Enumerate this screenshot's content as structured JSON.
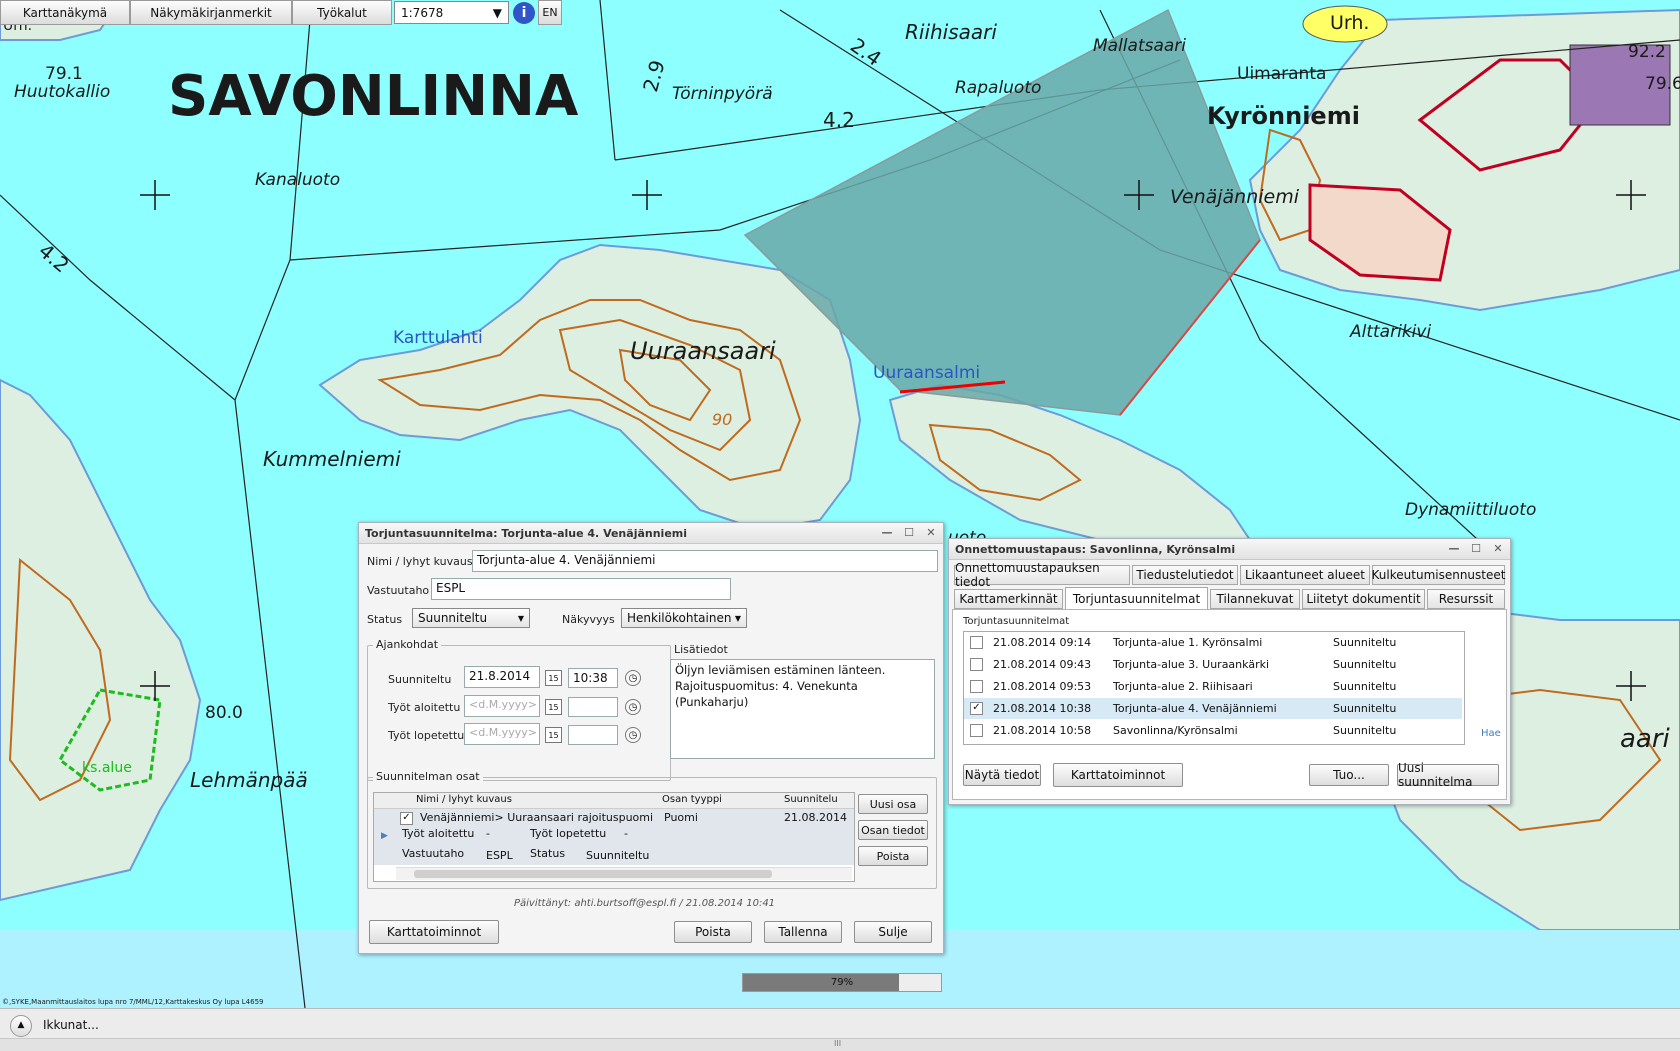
{
  "toolbar": {
    "items": [
      "Karttanäkymä",
      "Näkymäkirjanmerkit",
      "Työkalut"
    ],
    "scale": "1:7678",
    "info_icon": "info-icon",
    "lang": "EN"
  },
  "map": {
    "labels": {
      "savonlinna": "SAVONLINNA",
      "huutokallio": "Huutokallio",
      "height_79_1": "79.1",
      "kanaluoto": "Kanaluoto",
      "tornipyora": "Törninpyörä",
      "riihisaari": "Riihisaari",
      "mallatsaari": "Mallatsaari",
      "rapaluoto": "Rapaluoto",
      "kyronniemi": "Kyrönniemi",
      "uimaranta": "Uimaranta",
      "urh": "Urh.",
      "venajanniemi": "Venäjänniemi",
      "alttarikivi": "Alttarikivi",
      "karttulahti": "Karttulahti",
      "uuraansaari": "Uuraansaari",
      "uuraansalmi": "Uuraansalmi",
      "kummelniemi": "Kummelniemi",
      "dynamiittiluoto": "Dynamiittiluoto",
      "lehmanpaa": "Lehmänpää",
      "height_80_0": "80.0",
      "height_92_2": "92.2",
      "height_79_6": "79.6",
      "depth_4_2a": "4.2",
      "depth_4_2b": "4.2",
      "depth_2_4": "2.4",
      "depth_2_9": "2.9",
      "contour_90": "90",
      "ks_alue": "ks.alue",
      "urh_left": "Urh.",
      "saari_partial": "aari",
      "luoto_partial": "uoto"
    },
    "copyright": "©,SYKE,Maanmittauslaitos lupa nro 7/MML/12,Karttakeskus Oy lupa L4659",
    "colors": {
      "water": "#8effff",
      "land": "#dcefe0",
      "contour": "#c06a1e",
      "polygon": "#6aa8a8"
    }
  },
  "plan_window": {
    "title": "Torjuntasuunnitelma: Torjunta-alue 4. Venäjänniemi",
    "name_label": "Nimi / lyhyt kuvaus",
    "name_value": "Torjunta-alue 4. Venäjänniemi",
    "responsible_label": "Vastuutaho",
    "responsible_value": "ESPL",
    "status_label": "Status",
    "status_value": "Suunniteltu",
    "visibility_label": "Näkyvyys",
    "visibility_value": "Henkilökohtainen",
    "times_group": "Ajankohdat",
    "planned_label": "Suunniteltu",
    "planned_date": "21.8.2014",
    "planned_time": "10:38",
    "started_label": "Työt aloitettu",
    "ended_label": "Työt lopetettu",
    "date_placeholder": "<d.M.yyyy>",
    "cal_day": "15",
    "extra_label": "Lisätiedot",
    "extra_lines": [
      "Öljyn leviämisen estäminen länteen.",
      "Rajoituspuomitus: 4. Venekunta (Punkaharju)"
    ],
    "parts_group": "Suunnitelman osat",
    "parts_columns": [
      "Nimi / lyhyt kuvaus",
      "Osan tyyppi",
      "Suunnitelu"
    ],
    "part_row": {
      "name": "Venäjänniemi> Uuraansaari rajoituspuomi",
      "type": "Puomi",
      "date": "21.08.2014"
    },
    "part_detail": {
      "started_label": "Työt aloitettu",
      "started_value": "-",
      "ended_label": "Työt lopetettu",
      "ended_value": "-",
      "resp_label": "Vastuutaho",
      "resp_value": "ESPL",
      "status_label": "Status",
      "status_value": "Suunniteltu"
    },
    "part_buttons": [
      "Uusi osa",
      "Osan tiedot",
      "Poista"
    ],
    "updated": "Päivittänyt: ahti.burtsoff@espl.fi / 21.08.2014 10:41",
    "buttons": {
      "map_ops": "Karttatoiminnot",
      "delete": "Poista",
      "save": "Tallenna",
      "close": "Sulje"
    }
  },
  "incident_window": {
    "title": "Onnettomuustapaus: Savonlinna, Kyrönsalmi",
    "tabs_row1": [
      "Onnettomuustapauksen tiedot",
      "Tiedustelutiedot",
      "Likaantuneet alueet",
      "Kulkeutumisennusteet"
    ],
    "tabs_row2": [
      "Karttamerkinnät",
      "Torjuntasuunnitelmat",
      "Tilannekuvat",
      "Liitetyt dokumentit",
      "Resurssit"
    ],
    "active_tab": "Torjuntasuunnitelmat",
    "list_label": "Torjuntasuunnitelmat",
    "rows": [
      {
        "checked": false,
        "date": "21.08.2014 09:14",
        "name": "Torjunta-alue 1. Kyrönsalmi",
        "status": "Suunniteltu"
      },
      {
        "checked": false,
        "date": "21.08.2014 09:43",
        "name": "Torjunta-alue 3. Uuraankärki",
        "status": "Suunniteltu"
      },
      {
        "checked": false,
        "date": "21.08.2014 09:53",
        "name": "Torjunta-alue 2. Riihisaari",
        "status": "Suunniteltu"
      },
      {
        "checked": true,
        "date": "21.08.2014 10:38",
        "name": "Torjunta-alue 4. Venäjänniemi",
        "status": "Suunniteltu"
      },
      {
        "checked": false,
        "date": "21.08.2014 10:58",
        "name": "Savonlinna/Kyrönsalmi",
        "status": "Suunniteltu"
      }
    ],
    "search_link": "Hae",
    "buttons": {
      "show": "Näytä tiedot",
      "map_ops": "Karttatoiminnot",
      "import": "Tuo...",
      "new_plan": "Uusi suunnitelma"
    }
  },
  "progress": {
    "value": 0.79,
    "label": "79%"
  },
  "statusbar": {
    "windows": "Ikkunat...",
    "handle": "III"
  }
}
